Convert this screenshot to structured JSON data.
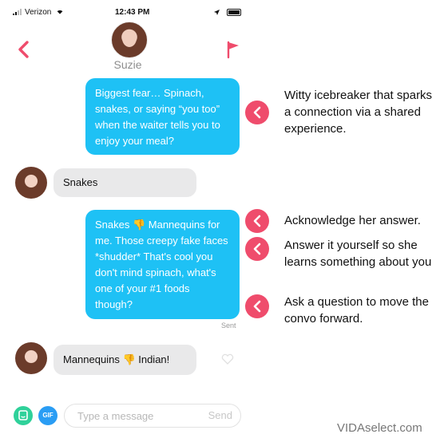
{
  "status_bar": {
    "carrier": "Verizon",
    "time": "12:43 PM"
  },
  "header": {
    "contact_name": "Suzie"
  },
  "messages": {
    "sent_1": "Biggest fear… Spinach, snakes, or saying “you too” when the waiter tells you to enjoy your meal?",
    "received_1": "Snakes",
    "sent_2": "Snakes 👎  Mannequins for me. Those creepy fake faces *shudder* That's cool you don't mind spinach, what's one of your #1 foods though?",
    "sent_status": "Sent",
    "received_2": "Mannequins 👎  Indian!"
  },
  "composer": {
    "gif_label": "GIF",
    "placeholder": "Type a message",
    "send_label": "Send"
  },
  "annotations": [
    {
      "text": "Witty icebreaker that sparks a connection via a shared experience."
    },
    {
      "text": "Acknowledge her answer."
    },
    {
      "text": "Answer it yourself so she learns something about you"
    },
    {
      "text": "Ask a question to move the convo forward."
    }
  ],
  "watermark": "VIDAselect.com",
  "colors": {
    "accent": "#ef4c6c",
    "bubble_sent": "#1ec1f5",
    "bubble_received": "#e9e9ea"
  }
}
